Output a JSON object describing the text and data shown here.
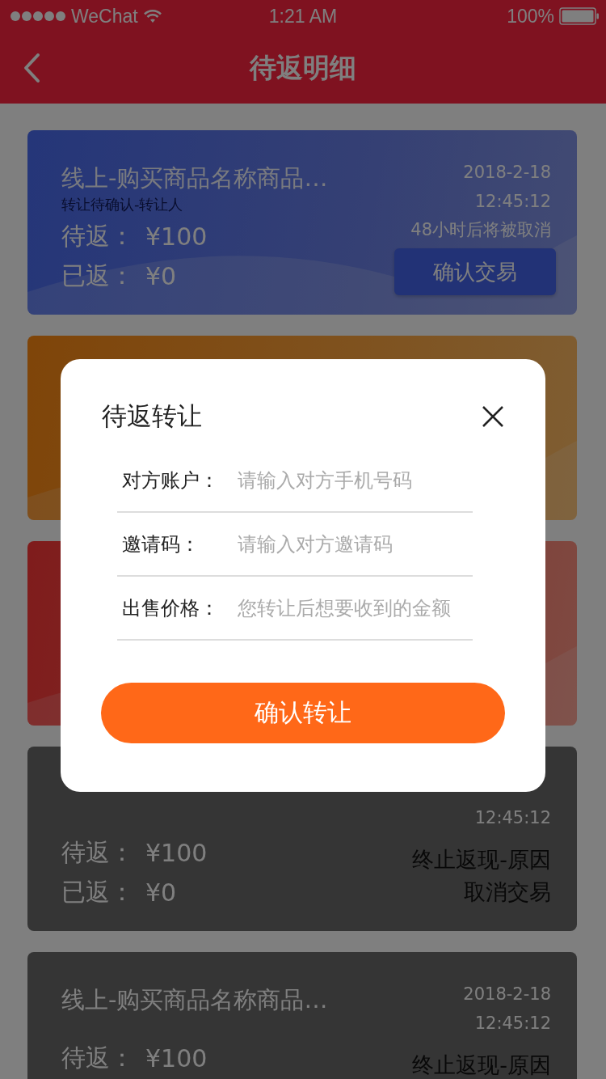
{
  "status_bar": {
    "carrier": "WeChat",
    "time": "1:21 AM",
    "battery": "100%"
  },
  "nav": {
    "title": "待返明细"
  },
  "cards": [
    {
      "kind": "blue",
      "title": "线上-购买商品名称商品…",
      "subtitle": "转让待确认-转让人",
      "date": "2018-2-18",
      "time": "12:45:12",
      "notice": "48小时后将被取消",
      "pending_label": "待返：",
      "pending_amount": "¥100",
      "returned_label": "已返：",
      "returned_amount": "¥0",
      "action": "确认交易"
    },
    {
      "kind": "orange"
    },
    {
      "kind": "red"
    },
    {
      "kind": "grey",
      "time": "12:45:12",
      "pending_label": "待返：",
      "pending_amount": "¥100",
      "returned_label": "已返：",
      "returned_amount": "¥0",
      "status_lines": [
        "终止返现-原因",
        "取消交易"
      ]
    },
    {
      "kind": "grey",
      "title": "线上-购买商品名称商品…",
      "date": "2018-2-18",
      "time": "12:45:12",
      "pending_label": "待返：",
      "pending_amount": "¥100",
      "status_lines": [
        "终止返现-原因"
      ]
    }
  ],
  "dialog": {
    "title": "待返转让",
    "fields": [
      {
        "label": "对方账户：",
        "placeholder": "请输入对方手机号码"
      },
      {
        "label": "邀请码：",
        "placeholder": "请输入对方邀请码"
      },
      {
        "label": "出售价格：",
        "placeholder": "您转让后想要收到的金额"
      }
    ],
    "confirm_button": "确认转让"
  }
}
